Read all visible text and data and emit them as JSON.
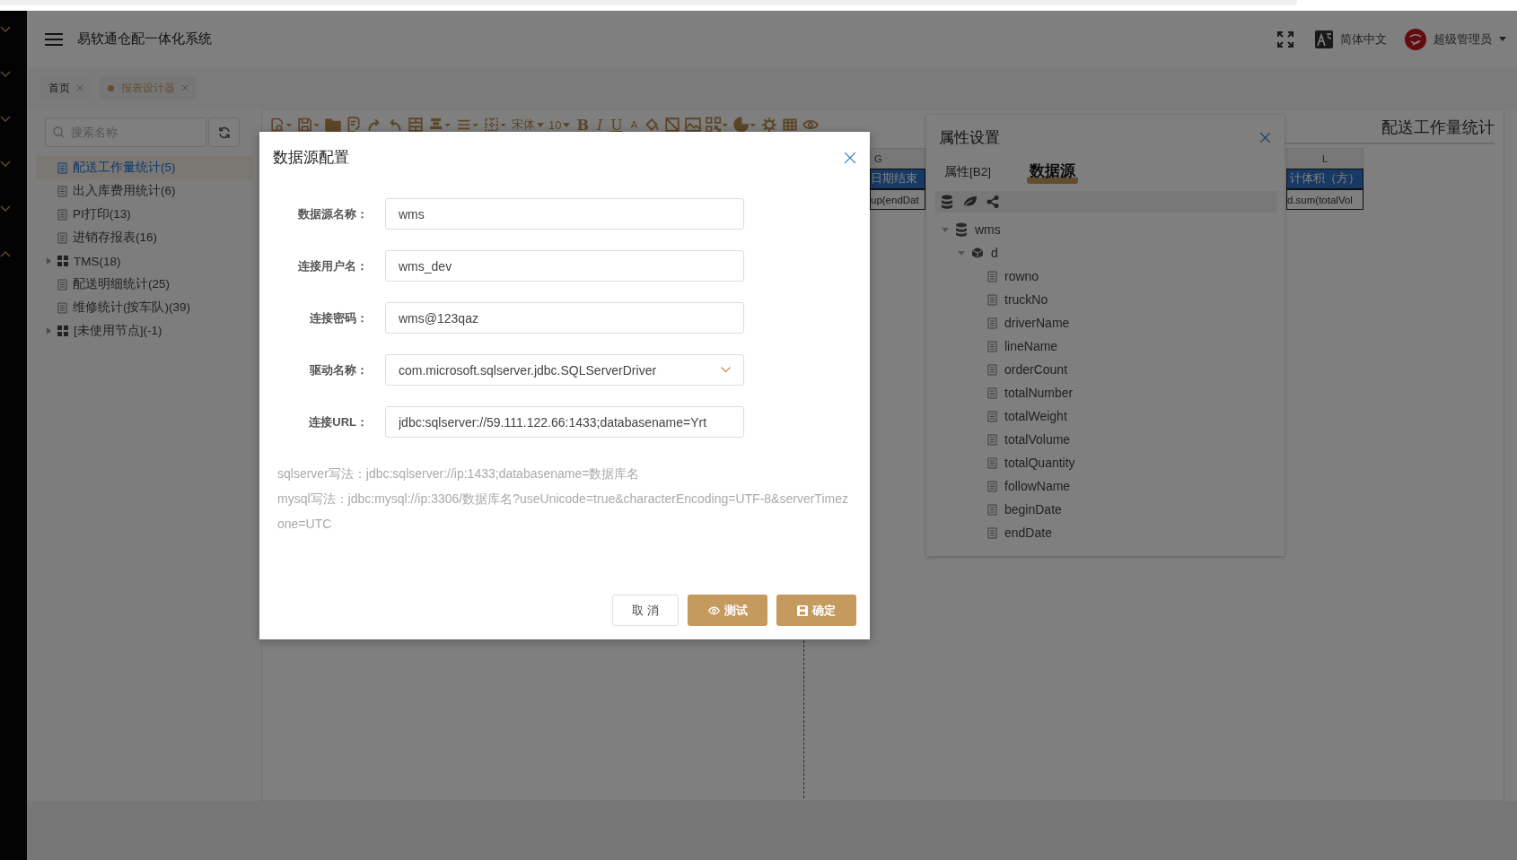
{
  "sidebar": {
    "groups": [
      {
        "expanded": false
      },
      {
        "expanded": false
      },
      {
        "expanded": false
      },
      {
        "expanded": false
      },
      {
        "expanded": false
      },
      {
        "expanded": true
      }
    ]
  },
  "header": {
    "title": "易软通仓配一体化系统",
    "language": "简体中文",
    "user": "超级管理员"
  },
  "tabs": [
    {
      "label": "首页",
      "selected": false
    },
    {
      "label": "报表设计器",
      "selected": true
    }
  ],
  "report_tree": {
    "search": {
      "placeholder": "搜索名称"
    },
    "items": [
      {
        "label": "配送工作量统计(5)",
        "kind": "report",
        "selected": true
      },
      {
        "label": "出入库费用统计(6)",
        "kind": "report",
        "selected": false
      },
      {
        "label": "PI打印(13)",
        "kind": "report",
        "selected": false
      },
      {
        "label": "进销存报表(16)",
        "kind": "report",
        "selected": false
      },
      {
        "label": "TMS(18)",
        "kind": "folder",
        "expanded": false,
        "selected": false
      },
      {
        "label": "配送明细统计(25)",
        "kind": "report",
        "selected": false
      },
      {
        "label": "维修统计(按车队)(39)",
        "kind": "report",
        "selected": false
      },
      {
        "label": "[未使用节点](-1)",
        "kind": "folder",
        "expanded": false,
        "selected": false
      }
    ]
  },
  "toolbar": {
    "font": "宋体",
    "font_size": "10",
    "format_buttons": [
      "B",
      "I",
      "U",
      "A"
    ]
  },
  "sheet": {
    "title": "配送工作量统计",
    "columns": [
      {
        "header": "G",
        "title": "日期结束",
        "formula": "up(endDat"
      },
      {
        "header": "L",
        "title": "计体积（方）",
        "formula": "d.sum(totalVol"
      }
    ]
  },
  "properties_panel": {
    "title": "属性设置",
    "tabs": [
      {
        "label": "属性[B2]",
        "selected": false
      },
      {
        "label": "数据源",
        "selected": true
      }
    ],
    "tree": [
      {
        "label": "wms",
        "kind": "database",
        "expanded": true,
        "children": [
          {
            "label": "d",
            "kind": "dataset",
            "expanded": true,
            "children": [
              {
                "label": "rowno",
                "kind": "field"
              },
              {
                "label": "truckNo",
                "kind": "field"
              },
              {
                "label": "driverName",
                "kind": "field"
              },
              {
                "label": "lineName",
                "kind": "field"
              },
              {
                "label": "orderCount",
                "kind": "field"
              },
              {
                "label": "totalNumber",
                "kind": "field"
              },
              {
                "label": "totalWeight",
                "kind": "field"
              },
              {
                "label": "totalVolume",
                "kind": "field"
              },
              {
                "label": "totalQuantity",
                "kind": "field"
              },
              {
                "label": "followName",
                "kind": "field"
              },
              {
                "label": "beginDate",
                "kind": "field"
              },
              {
                "label": "endDate",
                "kind": "field"
              }
            ]
          }
        ]
      }
    ]
  },
  "dialog": {
    "title": "数据源配置",
    "fields": [
      {
        "label": "数据源名称：",
        "value": "wms",
        "kind": "text"
      },
      {
        "label": "连接用户名：",
        "value": "wms_dev",
        "kind": "text"
      },
      {
        "label": "连接密码：",
        "value": "wms@123qaz",
        "kind": "text"
      },
      {
        "label": "驱动名称：",
        "value": "com.microsoft.sqlserver.jdbc.SQLServerDriver",
        "kind": "select"
      },
      {
        "label": "连接URL：",
        "value": "jdbc:sqlserver://59.111.122.66:1433;databasename=Yrt",
        "kind": "text"
      }
    ],
    "hints": [
      "sqlserver写法：jdbc:sqlserver://ip:1433;databasename=数据库名",
      "mysql写法：jdbc:mysql://ip:3306/数据库名?useUnicode=true&characterEncoding=UTF-8&serverTimezone=UTC"
    ],
    "buttons": [
      {
        "label": "取 消",
        "kind": "cancel"
      },
      {
        "label": "测试",
        "kind": "test"
      },
      {
        "label": "确定",
        "kind": "confirm"
      }
    ]
  }
}
